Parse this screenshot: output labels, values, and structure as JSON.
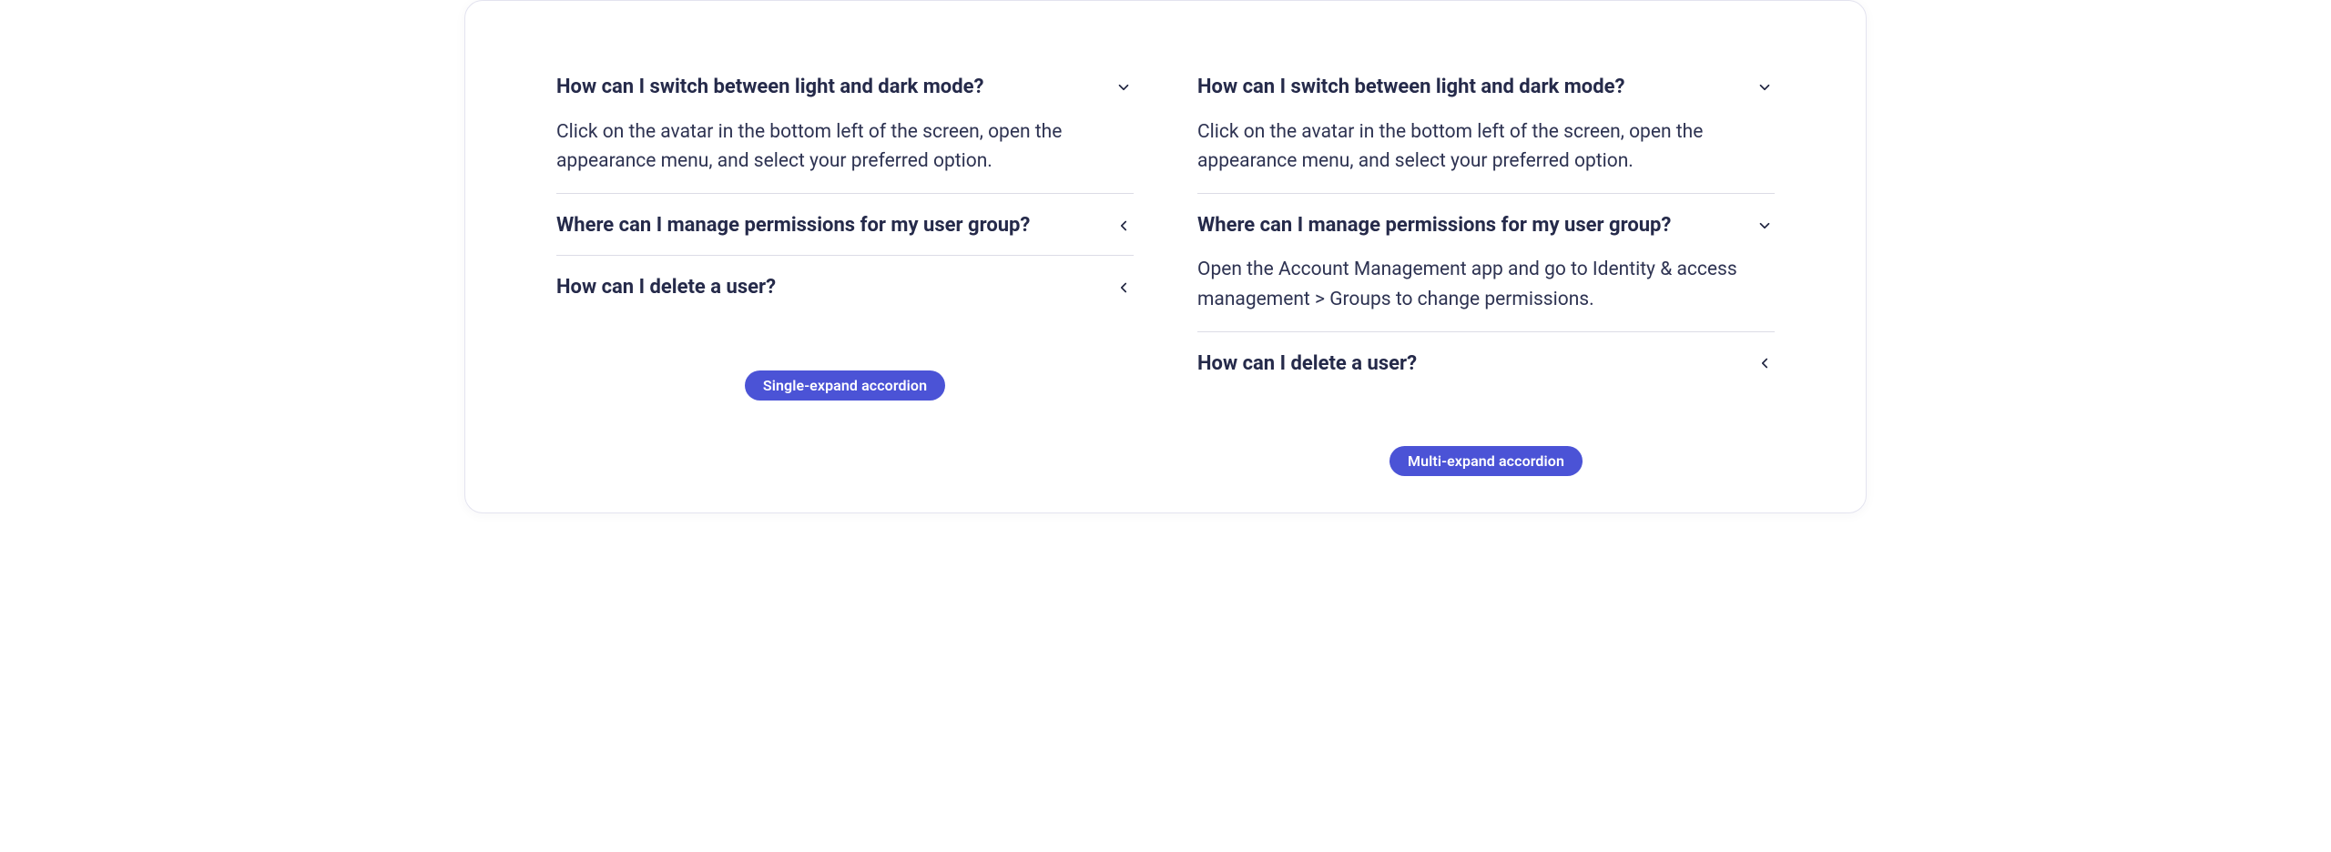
{
  "left": {
    "badge": "Single-expand accordion",
    "items": [
      {
        "q": "How can I switch between light and dark mode?",
        "a": "Click on the avatar in the bottom left of the screen, open the appearance menu, and select your preferred option.",
        "expanded": true
      },
      {
        "q": "Where can I manage permissions for my user group?",
        "expanded": false
      },
      {
        "q": "How can I delete a user?",
        "expanded": false
      }
    ]
  },
  "right": {
    "badge": "Multi-expand accordion",
    "items": [
      {
        "q": "How can I switch between light and dark mode?",
        "a": "Click on the avatar in the bottom left of the screen, open the appearance menu, and select your preferred option.",
        "expanded": true
      },
      {
        "q": "Where can I manage permissions for my user group?",
        "a": "Open the Account Management app and go to Identity & access management > Groups to change permissions.",
        "expanded": true
      },
      {
        "q": "How can I delete a user?",
        "expanded": false
      }
    ]
  }
}
